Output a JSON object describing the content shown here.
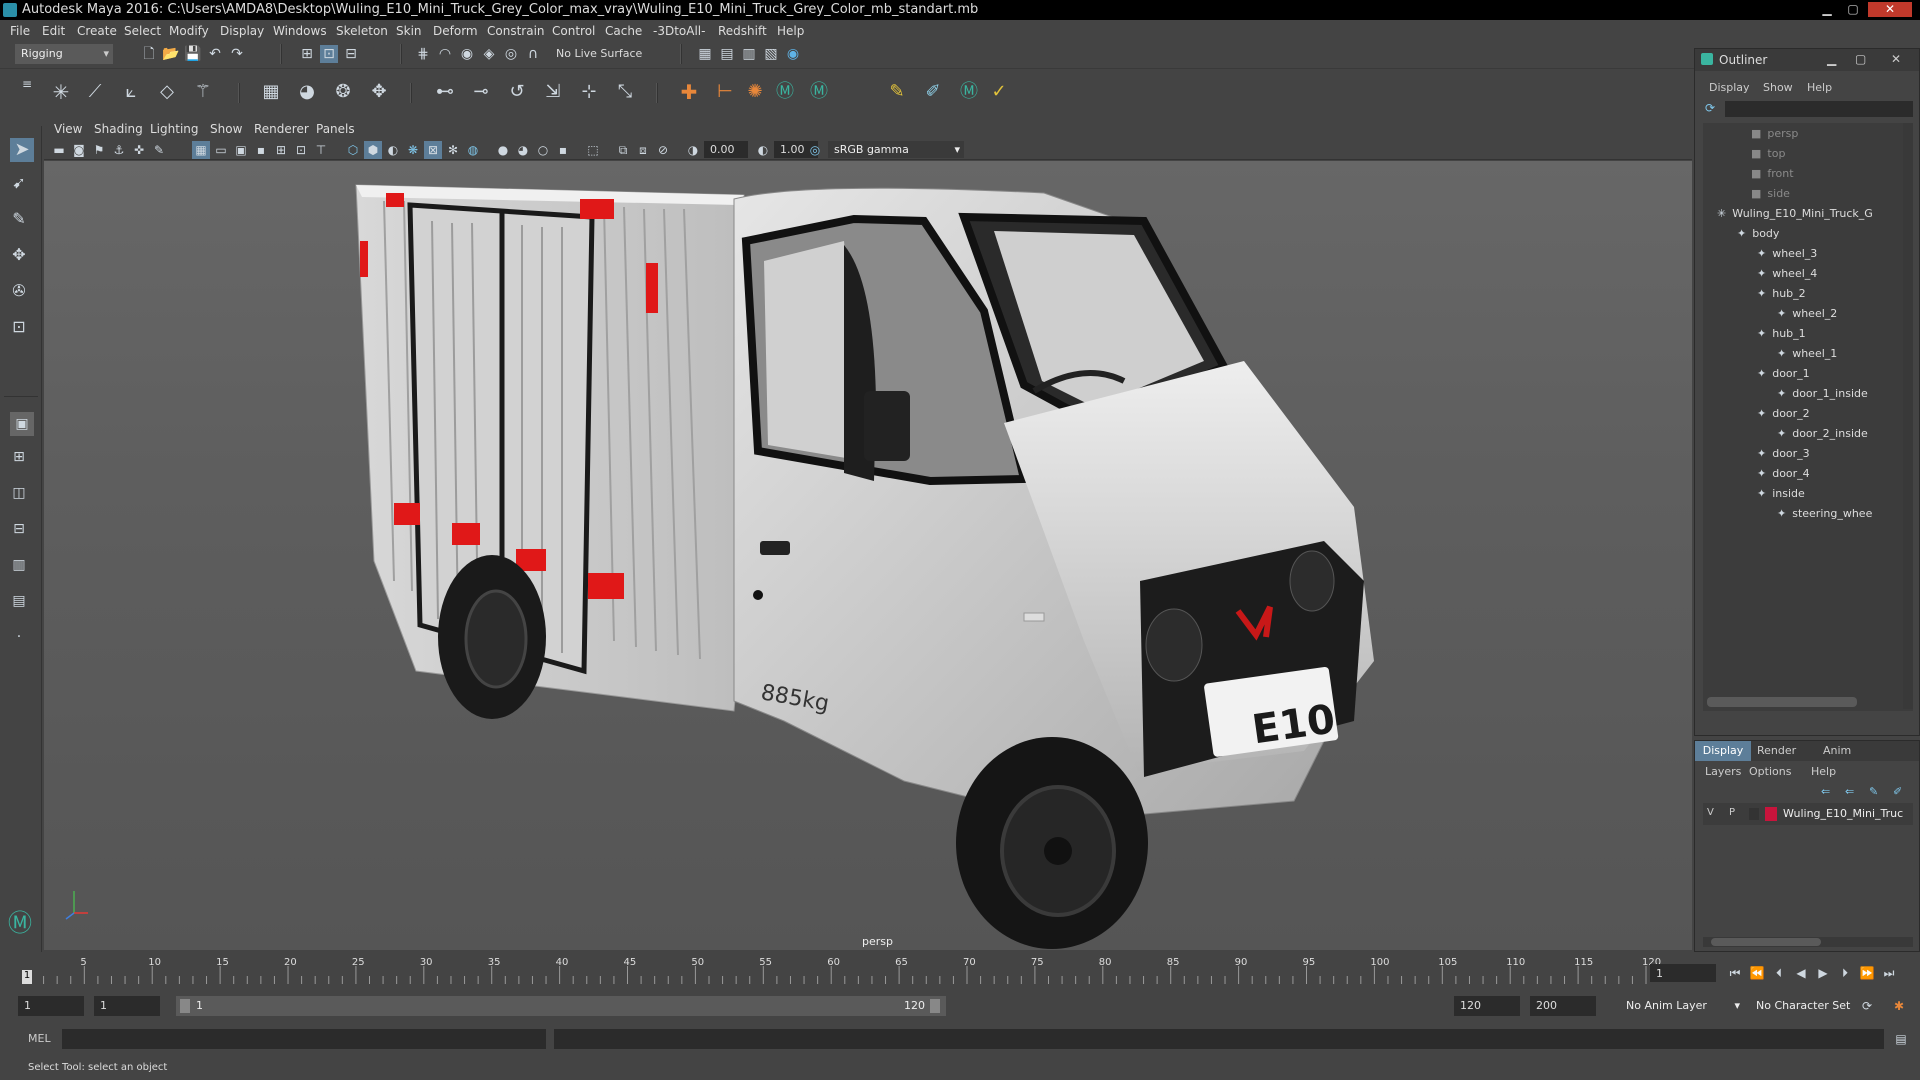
{
  "window": {
    "title": "Autodesk Maya 2016: C:\\Users\\AMDA8\\Desktop\\Wuling_E10_Mini_Truck_Grey_Color_max_vray\\Wuling_E10_Mini_Truck_Grey_Color_mb_standart.mb"
  },
  "menu": [
    "File",
    "Edit",
    "Create",
    "Select",
    "Modify",
    "Display",
    "Windows",
    "Skeleton",
    "Skin",
    "Deform",
    "Constrain",
    "Control",
    "Cache",
    "-3DtoAll-",
    "Redshift",
    "Help"
  ],
  "status": {
    "mode": "Rigging",
    "live_surface": "No Live Surface"
  },
  "viewport": {
    "menu": [
      "View",
      "Shading",
      "Lighting",
      "Show",
      "Renderer",
      "Panels"
    ],
    "gamma_value": "0.00",
    "exposure_value": "1.00",
    "color_space": "sRGB gamma",
    "camera_label": "persp",
    "truck_plate": "E10",
    "truck_weight": "885kg"
  },
  "outliner": {
    "title": "Outliner",
    "menu": [
      "Display",
      "Show",
      "Help"
    ],
    "items": [
      {
        "label": "persp",
        "indent": 0,
        "dim": true
      },
      {
        "label": "top",
        "indent": 0,
        "dim": true
      },
      {
        "label": "front",
        "indent": 0,
        "dim": true
      },
      {
        "label": "side",
        "indent": 0,
        "dim": true
      },
      {
        "label": "Wuling_E10_Mini_Truck_G",
        "indent": 0,
        "dim": false
      },
      {
        "label": "body",
        "indent": 1,
        "dim": false
      },
      {
        "label": "wheel_3",
        "indent": 2,
        "dim": false
      },
      {
        "label": "wheel_4",
        "indent": 2,
        "dim": false
      },
      {
        "label": "hub_2",
        "indent": 2,
        "dim": false
      },
      {
        "label": "wheel_2",
        "indent": 3,
        "dim": false
      },
      {
        "label": "hub_1",
        "indent": 2,
        "dim": false
      },
      {
        "label": "wheel_1",
        "indent": 3,
        "dim": false
      },
      {
        "label": "door_1",
        "indent": 2,
        "dim": false
      },
      {
        "label": "door_1_inside",
        "indent": 3,
        "dim": false
      },
      {
        "label": "door_2",
        "indent": 2,
        "dim": false
      },
      {
        "label": "door_2_inside",
        "indent": 3,
        "dim": false
      },
      {
        "label": "door_3",
        "indent": 2,
        "dim": false
      },
      {
        "label": "door_4",
        "indent": 2,
        "dim": false
      },
      {
        "label": "inside",
        "indent": 2,
        "dim": false
      },
      {
        "label": "steering_whee",
        "indent": 3,
        "dim": false
      }
    ]
  },
  "layers": {
    "tabs": [
      "Display",
      "Render",
      "Anim"
    ],
    "menu": [
      "Layers",
      "Options",
      "Help"
    ],
    "row": {
      "v": "V",
      "p": "P",
      "name": "Wuling_E10_Mini_Truc",
      "color": "#c8143c"
    }
  },
  "timeline": {
    "ticks": [
      "5",
      "10",
      "15",
      "20",
      "25",
      "30",
      "35",
      "40",
      "45",
      "50",
      "55",
      "60",
      "65",
      "70",
      "75",
      "80",
      "85",
      "90",
      "95",
      "100",
      "105",
      "110",
      "115",
      "120"
    ],
    "start_tick": "1",
    "current_frame": "1"
  },
  "range": {
    "start": "1",
    "start2": "1",
    "slider_start": "1",
    "slider_end": "120",
    "end": "120",
    "max": "200",
    "anim_layer": "No Anim Layer",
    "char_set": "No Character Set"
  },
  "mel": {
    "label": "MEL"
  },
  "help": {
    "text": "Select Tool: select an object"
  }
}
